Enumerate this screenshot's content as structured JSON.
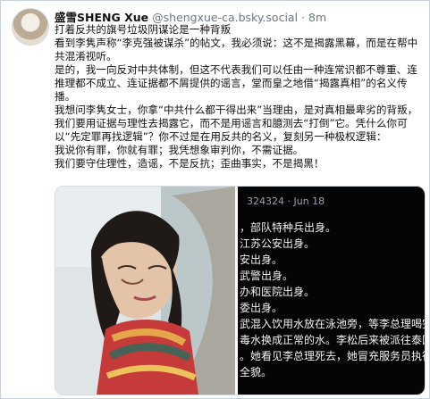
{
  "post": {
    "author_name": "盛雪SHENG Xue",
    "handle": "@shengxue-ca.bsky.social",
    "separator": "·",
    "time": "8m",
    "paragraphs": [
      "打着反共的旗号垃圾阴谋论是一种背叛",
      "看到李隽声称“李克强被谋杀”的帖文，我必须说：这不是揭露黑幕，而是在帮中共混淆视听。",
      "是的，我一向反对中共体制，但这不代表我们可以任由一种连常识都不尊重、连推理都不成立、连证据都不屑提供的谣言，堂而皇之地借“揭露真相”的名义传播。",
      "我想问李隽女士，你拿“中共什么都干得出来”当理由，是对真相最卑劣的背叛，我们要用证据与理性去揭露它，而不是用谣言和臆测去“打倒”它。凭什么你可以“先定罪再找逻辑”？你不过是在用反共的名义，复刻另一种极权逻辑：",
      "我说你有罪，你就有罪；我凭想象审判你，不需证据。",
      "我们要守住理性，造谣，不是反抗；歪曲事实，不是揭黑！"
    ]
  },
  "media": {
    "right_image": {
      "meta": "324324 · Jun 18",
      "lines": [
        "，部队特种兵出身。",
        "江苏公安出身。",
        "安出身。",
        "武警出身。",
        "办和医院出身。",
        "委出身。",
        "武混入饮用水放在泳池旁，等李总理喝完",
        "毒水换成正常的水。李松后来被派往泰国",
        "。她看见李总理死去，她冒充服务员执行",
        "全貌。"
      ]
    }
  }
}
